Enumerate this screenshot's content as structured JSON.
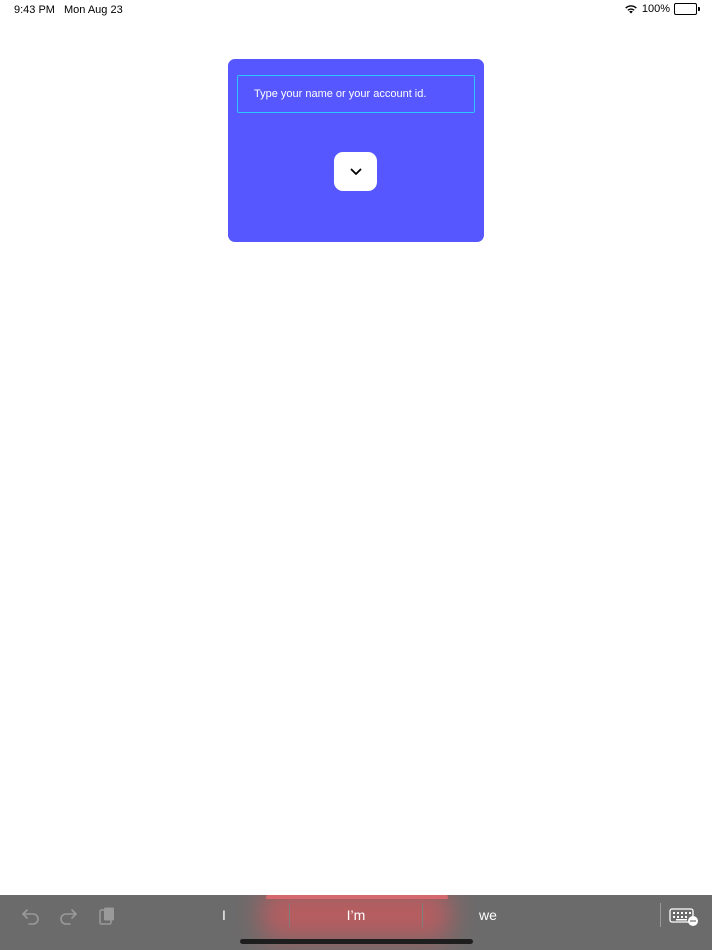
{
  "status_bar": {
    "time": "9:43 PM",
    "date": "Mon Aug 23",
    "battery": "100%"
  },
  "login_card": {
    "background_color": "#5757ff",
    "input_border_color": "#2ec5ff",
    "input_placeholder": "Type your name or your account id.",
    "input_value": "",
    "expand_icon": "chevron-down-icon"
  },
  "keyboard_bar": {
    "undo_icon": "undo-icon",
    "redo_icon": "redo-icon",
    "paste_icon": "paste-icon",
    "suggestions": [
      "I",
      "I’m",
      "we"
    ],
    "keyboard_icon": "keyboard-icon"
  }
}
